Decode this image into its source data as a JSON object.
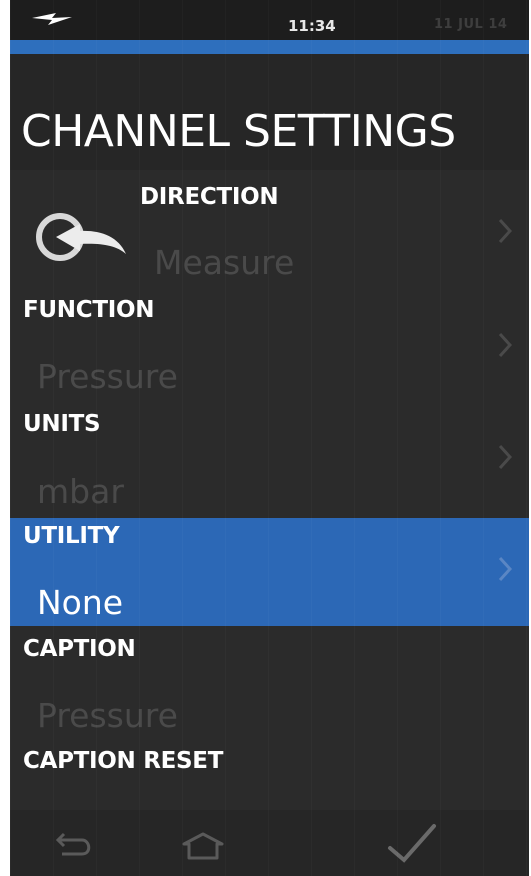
{
  "status_bar": {
    "time": "11:34",
    "date": "11 JUL 14",
    "power_icon": "charging-icon"
  },
  "header": {
    "title": "CHANNEL SETTINGS"
  },
  "colors": {
    "accent": "#2e6fbd",
    "selected_row": "#2c68b6",
    "background": "#2b2b2b",
    "dimmed_value": "#4a4a4a"
  },
  "settings": {
    "direction": {
      "label": "DIRECTION",
      "value": "Measure"
    },
    "function": {
      "label": "FUNCTION",
      "value": "Pressure"
    },
    "units": {
      "label": "UNITS",
      "value": "mbar"
    },
    "utility": {
      "label": "UTILITY",
      "value": "None",
      "selected": true
    },
    "caption": {
      "label": "CAPTION",
      "value": "Pressure"
    },
    "caption_reset": {
      "label": "CAPTION RESET"
    }
  },
  "icons": {
    "back": "back-arrow-icon",
    "chevron": "chevron-right-icon",
    "nav_back": "return-arrow-icon",
    "nav_home": "home-icon",
    "nav_confirm": "checkmark-icon"
  }
}
